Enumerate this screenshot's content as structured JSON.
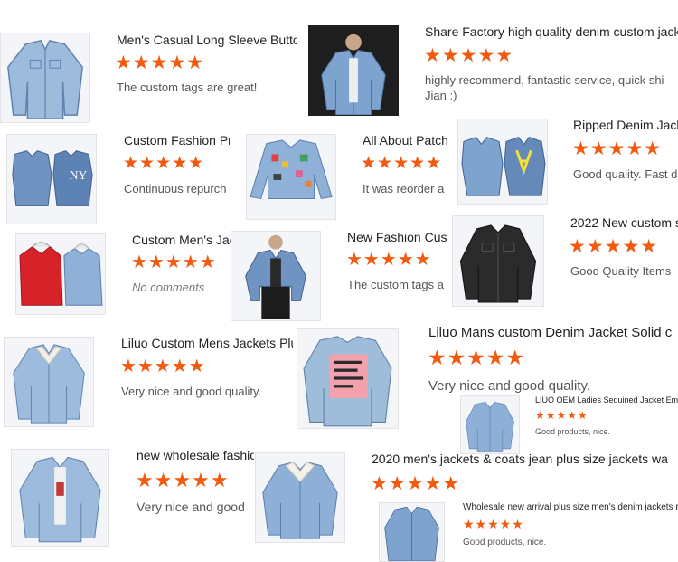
{
  "colors": {
    "star": "#f25a0f",
    "denim_light": "#9dbbdc",
    "denim_mid": "#6f94c2",
    "denim_dark": "#3e5f8f",
    "black_jacket": "#2b2b2b",
    "red_jacket": "#d8222a"
  },
  "rating_glyph": "★★★★★",
  "reviews": [
    {
      "title": "Men's Casual Long Sleeve Butto",
      "text": "The custom tags are great!",
      "image_icon": "denim-jacket-icon"
    },
    {
      "title": "Share Factory high quality denim custom jacke",
      "text": "highly recommend, fantastic service, quick shi",
      "text2": "Jian :)",
      "image_icon": "denim-jacket-icon"
    },
    {
      "title": "Custom Fashion Pr",
      "text": "Continuous repurch",
      "image_icon": "denim-jacket-icon"
    },
    {
      "title": "All About Patch",
      "text": "It was reorder a",
      "image_icon": "patch-jacket-icon"
    },
    {
      "title": "Ripped Denim Jack",
      "text": "Good quality. Fast d",
      "image_icon": "denim-jacket-icon"
    },
    {
      "title": "Custom Men's Jac",
      "text": "No comments",
      "image_icon": "hoodie-jacket-icon"
    },
    {
      "title": "New Fashion Cust",
      "text": "The custom tags a",
      "image_icon": "denim-jacket-icon"
    },
    {
      "title": "2022 New custom s",
      "text": "Good Quality Items",
      "image_icon": "black-jacket-icon"
    },
    {
      "title": "Liluo Custom Mens Jackets Plu",
      "text": "Very nice and good quality.",
      "image_icon": "sherpa-jacket-icon"
    },
    {
      "title": "Liluo Mans custom Denim Jacket Solid c",
      "text": "Very nice and good quality.",
      "image_icon": "painted-jacket-icon"
    },
    {
      "title": "LIUO OEM Ladies Sequined Jacket Emb",
      "text": "Good products, nice.",
      "image_icon": "denim-jacket-icon"
    },
    {
      "title": "new wholesale fashio",
      "text": "Very nice and good",
      "image_icon": "denim-jacket-icon"
    },
    {
      "title": "2020 men's jackets & coats jean plus size jackets wa",
      "text": "",
      "image_icon": "sherpa-jacket-icon"
    },
    {
      "title": "Wholesale new arrival plus size men's denim jackets r",
      "text": "Good products, nice.",
      "image_icon": "denim-jacket-icon"
    }
  ]
}
